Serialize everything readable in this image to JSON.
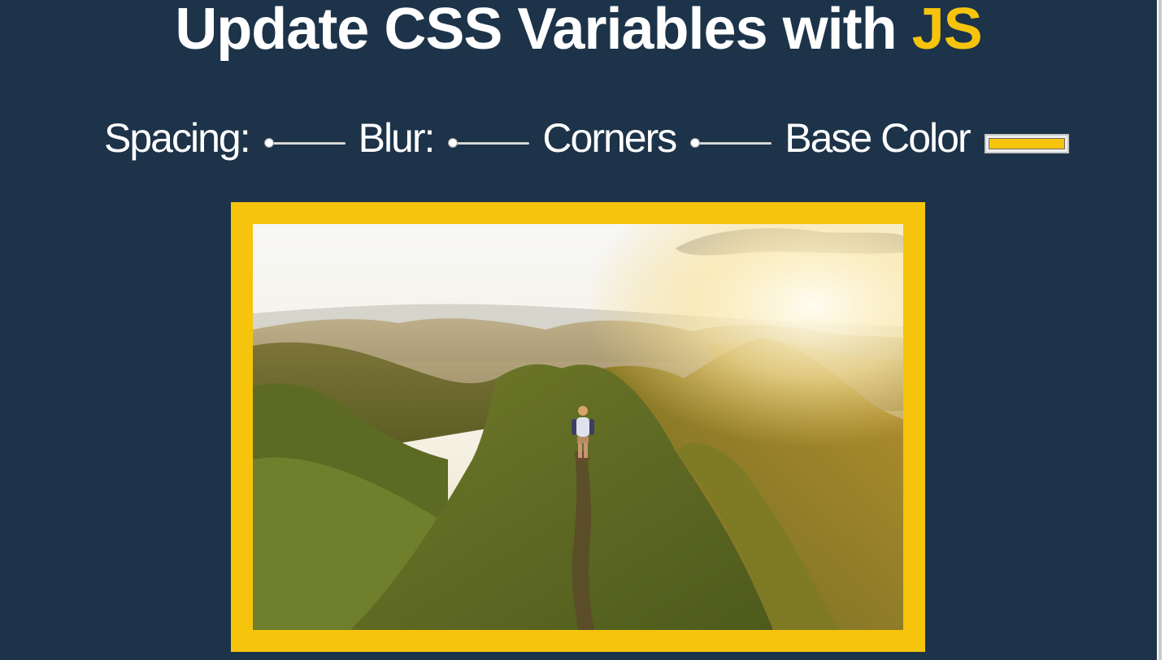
{
  "heading": {
    "prefix": "Update CSS Variables with ",
    "highlight": "JS"
  },
  "controls": {
    "spacing_label": "Spacing:",
    "spacing_value": 10,
    "spacing_min": 10,
    "spacing_max": 200,
    "blur_label": "Blur:",
    "blur_value": 0,
    "blur_min": 0,
    "blur_max": 25,
    "corners_label": "Corners",
    "corners_value": 0,
    "corners_min": 0,
    "corners_max": 100,
    "base_color_label": "Base Color",
    "base_color_value": "#f6c40c"
  },
  "colors": {
    "background": "#1d3349",
    "accent": "#f6c40c",
    "text": "#ffffff"
  },
  "image": {
    "alt": ""
  }
}
